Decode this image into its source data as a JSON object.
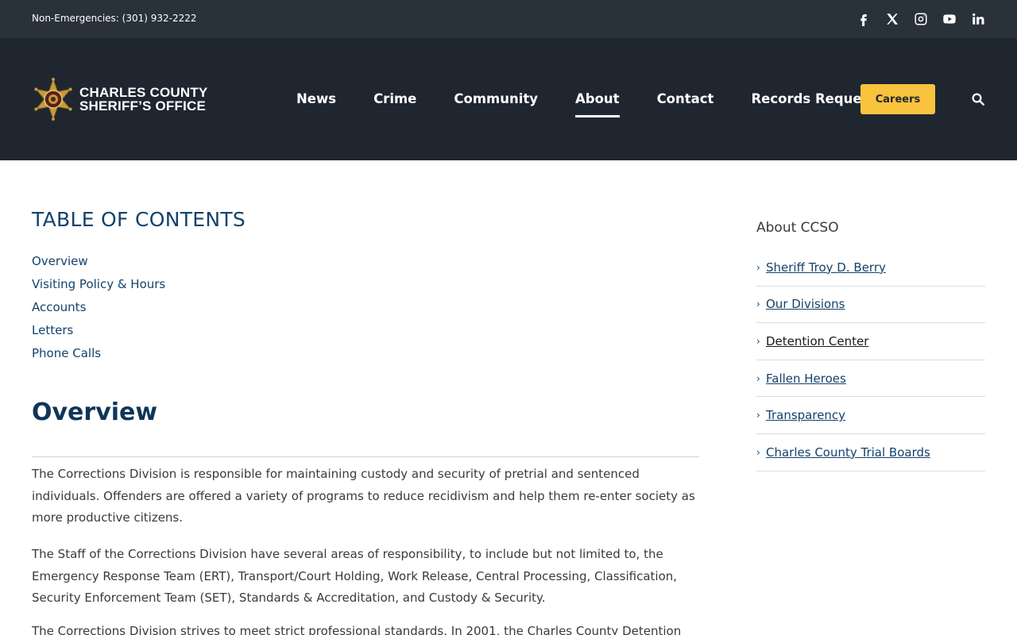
{
  "topbar": {
    "phone": "Non-Emergencies: (301) 932-2222",
    "social": [
      "facebook-icon",
      "x-icon",
      "instagram-icon",
      "youtube-icon",
      "linkedin-icon"
    ]
  },
  "header": {
    "logo_line1": "CHARLES COUNTY",
    "logo_line2": "SHERIFF’S OFFICE",
    "nav": [
      {
        "label": "News",
        "active": false
      },
      {
        "label": "Crime",
        "active": false
      },
      {
        "label": "Community",
        "active": false
      },
      {
        "label": "About",
        "active": true
      },
      {
        "label": "Contact",
        "active": false
      },
      {
        "label": "Records Requests",
        "active": false
      }
    ],
    "careers_label": "Careers",
    "accent": "#f9c33d",
    "bg": "#1f2630"
  },
  "main": {
    "toc_title": "TABLE OF CONTENTS",
    "toc": [
      "Overview",
      "Visiting Policy & Hours",
      "Accounts",
      "Letters",
      "Phone Calls"
    ],
    "section_title": "Overview",
    "paragraphs": [
      "The Corrections Division is responsible for maintaining custody and security of pretrial and sentenced individuals. Offenders are offered a variety of programs to reduce recidivism and help them re-enter society as more productive citizens.",
      "The Staff of the Corrections Division have several areas of responsibility, to include but not limited to, the Emergency Response Team (ERT), Transport/Court Holding, Work Release, Central Processing, Classification, Security Enforcement Team (SET), Standards & Accreditation, and Custody & Security.",
      "The Corrections Division strives to meet strict professional standards. In 2001, the Charles County Detention"
    ]
  },
  "sidebar": {
    "title": "About CCSO",
    "items": [
      {
        "label": "Sheriff Troy D. Berry",
        "current": false
      },
      {
        "label": "Our Divisions",
        "current": false
      },
      {
        "label": "Detention Center",
        "current": true
      },
      {
        "label": "Fallen Heroes",
        "current": false
      },
      {
        "label": "Transparency",
        "current": false
      },
      {
        "label": "Charles County Trial Boards",
        "current": false
      }
    ]
  }
}
